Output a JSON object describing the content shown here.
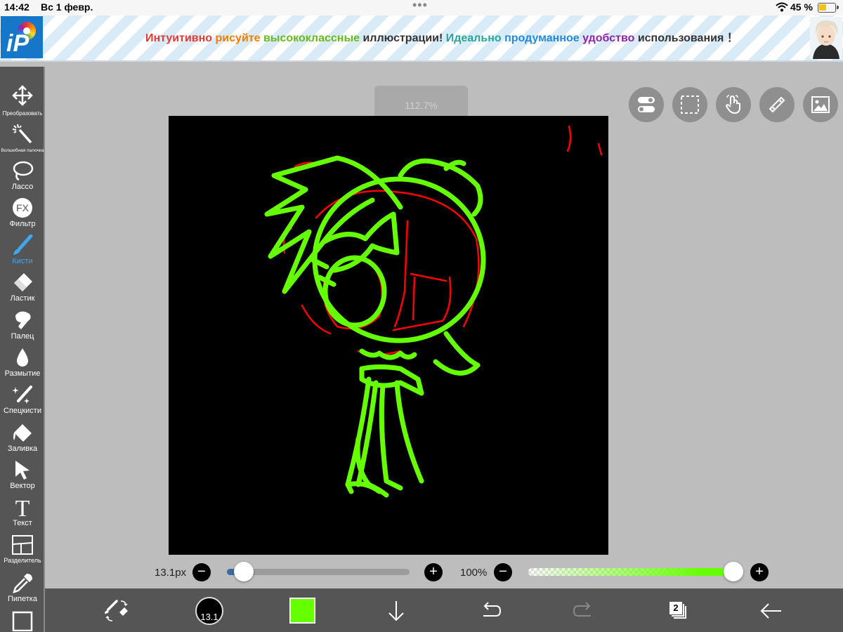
{
  "status_bar": {
    "time": "14:42",
    "date": "Вс 1 февр.",
    "battery_percent": "45 %",
    "battery_level": 0.45
  },
  "banner": {
    "words": [
      "Интуитивно",
      "рисуйте",
      "высококлассные",
      "иллюстрации!",
      "Идеально",
      "продуманное",
      "удобство",
      "использования",
      "！"
    ],
    "colors": [
      "#e53935",
      "#f57c00",
      "#6ab821",
      "#333333",
      "#26a69a",
      "#1e88e5",
      "#8e24aa",
      "#333333"
    ]
  },
  "tools": [
    {
      "label": "Преобразовать",
      "icon": "move-icon"
    },
    {
      "label": "Волшебная палочка",
      "icon": "magic-wand-icon"
    },
    {
      "label": "Лассо",
      "icon": "lasso-icon"
    },
    {
      "label": "Фильтр",
      "icon": "fx-icon",
      "icon_text": "FX"
    },
    {
      "label": "Кисти",
      "icon": "brush-icon",
      "active": true
    },
    {
      "label": "Ластик",
      "icon": "eraser-icon"
    },
    {
      "label": "Палец",
      "icon": "smudge-finger-icon"
    },
    {
      "label": "Размытие",
      "icon": "blur-drop-icon"
    },
    {
      "label": "Спецкисти",
      "icon": "special-brush-icon"
    },
    {
      "label": "Заливка",
      "icon": "fill-bucket-icon"
    },
    {
      "label": "Вектор",
      "icon": "vector-arrow-icon"
    },
    {
      "label": "Текст",
      "icon": "text-icon",
      "icon_text": "T"
    },
    {
      "label": "Разделитель",
      "icon": "divider-icon"
    },
    {
      "label": "Пипетка",
      "icon": "eyedropper-icon"
    }
  ],
  "canvas": {
    "zoom": "112.7%",
    "background_color": "#000000",
    "sketch_colors": [
      "#66ff00",
      "#ff0000"
    ]
  },
  "top_right_buttons": [
    "toggle-icon",
    "selection-icon",
    "gesture-hand-icon",
    "ruler-icon",
    "image-icon"
  ],
  "brush_settings": {
    "size_label": "13.1px",
    "size_level": 0.06,
    "opacity_label": "100%",
    "opacity_level": 1.0,
    "minus": "−",
    "plus": "+"
  },
  "bottom_bar": {
    "brush_size_value": "13.1",
    "current_color": "#66ff00",
    "layer_count": "2",
    "icons": [
      "brush-swap-icon",
      "download-arrow-icon",
      "undo-icon",
      "redo-icon",
      "back-arrow-icon"
    ]
  }
}
